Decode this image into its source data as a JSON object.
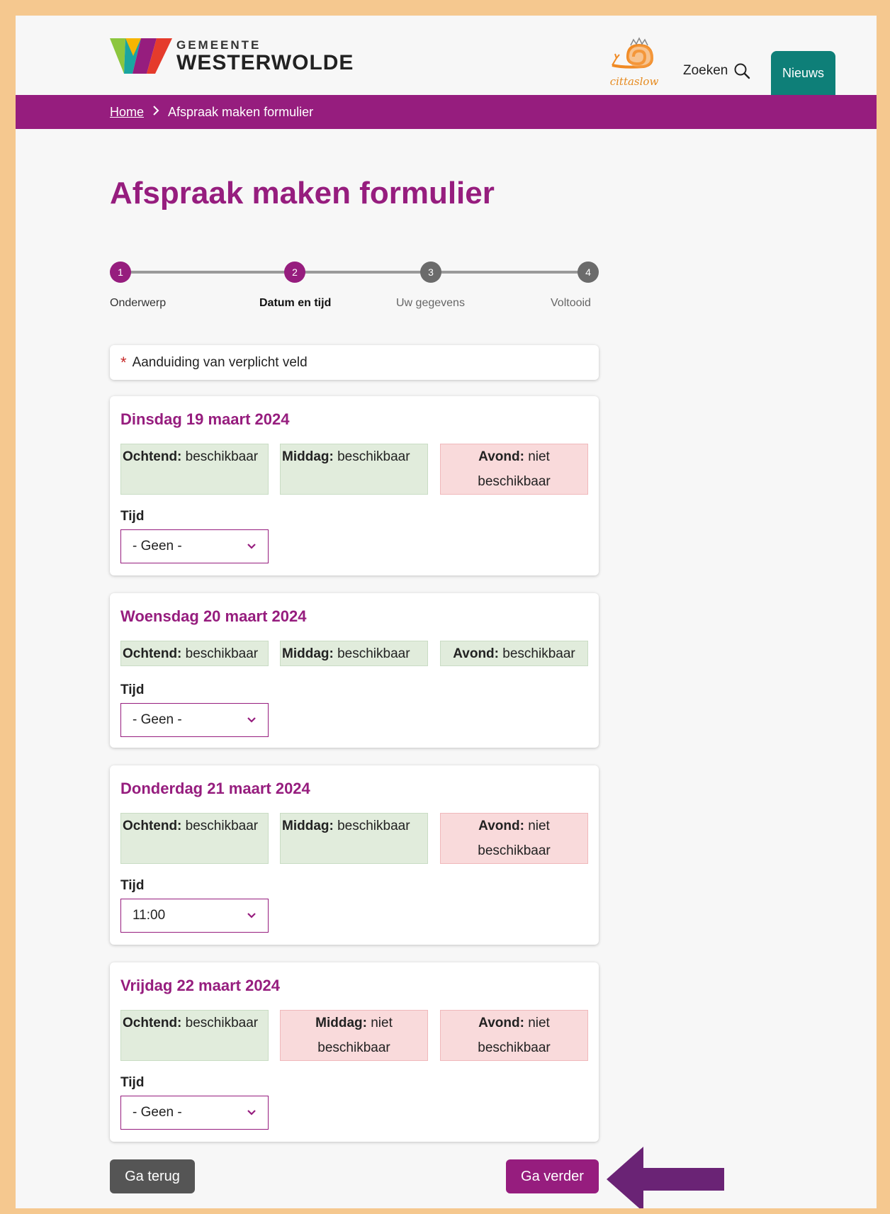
{
  "header": {
    "logo_small": "GEMEENTE",
    "logo_big": "WESTERWOLDE",
    "cittaslow": "cittaslow",
    "search_label": "Zoeken",
    "news_label": "Nieuws"
  },
  "breadcrumb": {
    "home": "Home",
    "current": "Afspraak maken formulier"
  },
  "page": {
    "title": "Afspraak maken formulier"
  },
  "steps": [
    {
      "num": "1",
      "label": "Onderwerp",
      "state": "done"
    },
    {
      "num": "2",
      "label": "Datum en tijd",
      "state": "current"
    },
    {
      "num": "3",
      "label": "Uw gegevens",
      "state": "todo"
    },
    {
      "num": "4",
      "label": "Voltooid",
      "state": "todo"
    }
  ],
  "required_note": {
    "star": "*",
    "text": "Aanduiding van verplicht veld"
  },
  "days": [
    {
      "title": "Dinsdag 19 maart 2024",
      "slots": [
        {
          "name": "Ochtend:",
          "status": "beschikbaar"
        },
        {
          "name": "Middag:",
          "status": "beschikbaar"
        },
        {
          "name": "Avond:",
          "status": "niet beschikbaar"
        }
      ],
      "time_label": "Tijd",
      "time_value": "- Geen -"
    },
    {
      "title": "Woensdag 20 maart 2024",
      "slots": [
        {
          "name": "Ochtend:",
          "status": "beschikbaar"
        },
        {
          "name": "Middag:",
          "status": "beschikbaar"
        },
        {
          "name": "Avond:",
          "status": "beschikbaar"
        }
      ],
      "time_label": "Tijd",
      "time_value": "- Geen -"
    },
    {
      "title": "Donderdag 21 maart 2024",
      "slots": [
        {
          "name": "Ochtend:",
          "status": "beschikbaar"
        },
        {
          "name": "Middag:",
          "status": "beschikbaar"
        },
        {
          "name": "Avond:",
          "status": "niet beschikbaar"
        }
      ],
      "time_label": "Tijd",
      "time_value": "11:00"
    },
    {
      "title": "Vrijdag 22 maart 2024",
      "slots": [
        {
          "name": "Ochtend:",
          "status": "beschikbaar"
        },
        {
          "name": "Middag:",
          "status": "niet beschikbaar"
        },
        {
          "name": "Avond:",
          "status": "niet beschikbaar"
        }
      ],
      "time_label": "Tijd",
      "time_value": "- Geen -"
    }
  ],
  "actions": {
    "back": "Ga terug",
    "next": "Ga verder"
  },
  "colors": {
    "brand": "#961d7e",
    "news": "#0e7f78",
    "available": "#e1ecdc",
    "unavailable": "#f9dadb",
    "frame": "#f5c88f",
    "arrow": "#6a2375"
  }
}
